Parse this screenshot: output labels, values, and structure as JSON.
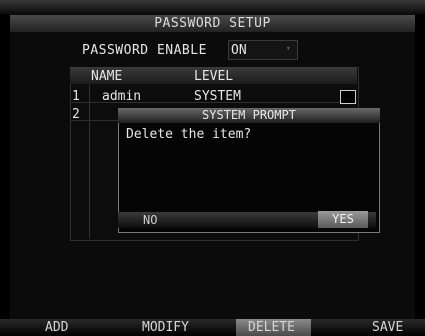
{
  "window": {
    "title": "PASSWORD SETUP"
  },
  "password_enable": {
    "label": "PASSWORD ENABLE",
    "value": "ON",
    "arrow": "▾"
  },
  "table": {
    "headers": {
      "name": "NAME",
      "level": "LEVEL"
    },
    "rows": [
      {
        "index": "1",
        "name": "admin",
        "level": "SYSTEM",
        "checked": false
      },
      {
        "index": "2",
        "name": "",
        "level": ""
      }
    ]
  },
  "dialog": {
    "title": "SYSTEM PROMPT",
    "message": "Delete the item?",
    "no_label": "NO",
    "yes_label": "YES"
  },
  "toolbar": {
    "add": "ADD",
    "modify": "MODIFY",
    "delete": "DELETE",
    "save": "SAVE",
    "active": "delete"
  }
}
